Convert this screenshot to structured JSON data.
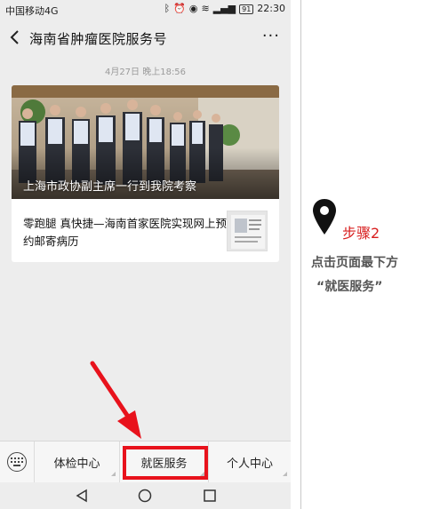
{
  "status_bar": {
    "carrier": "中国移动4G",
    "battery": "91",
    "time": "22:30"
  },
  "header": {
    "title": "海南省肿瘤医院服务号",
    "back_icon": "chevron-left-icon",
    "more_label": "···"
  },
  "chat": {
    "timestamp": "4月27日 晚上18:56"
  },
  "article": {
    "headline": "上海市政协副主席一行到我院考察",
    "subtitle": "零跑腿 真快捷—海南首家医院实现网上预约邮寄病历"
  },
  "menu": {
    "keyboard_icon": "keyboard-icon",
    "items": [
      {
        "label": "体检中心"
      },
      {
        "label": "就医服务"
      },
      {
        "label": "个人中心"
      }
    ]
  },
  "annotation": {
    "step": "步骤2",
    "line1": "点击页面最下方",
    "line2": "“就医服务”",
    "highlight_color": "#e8121c",
    "step_color": "#d81e1e"
  }
}
